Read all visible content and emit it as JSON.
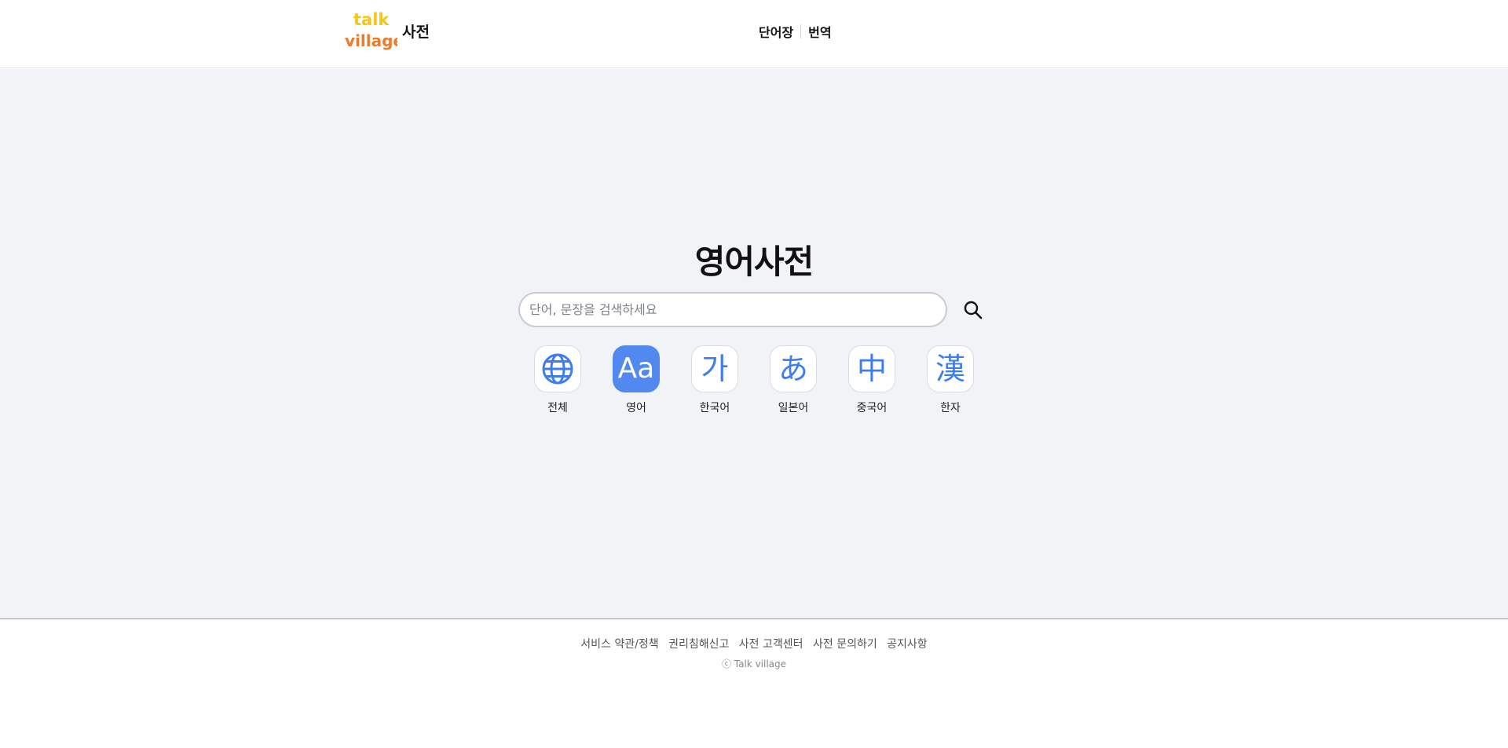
{
  "header": {
    "logo": {
      "line1": "talk",
      "line2": "village",
      "color_top": "#f5c518",
      "color_bottom": "#f07a2a"
    },
    "site_name": "사전",
    "nav": [
      {
        "label": "단어장"
      },
      {
        "label": "번역"
      }
    ]
  },
  "main": {
    "title": "영어사전",
    "search": {
      "placeholder": "단어, 문장을 검색하세요",
      "value": ""
    },
    "accent_color": "#5289f0",
    "categories": [
      {
        "glyph": "",
        "icon": "globe-icon",
        "label": "전체",
        "active": false
      },
      {
        "glyph": "Aa",
        "icon": "english-icon",
        "label": "영어",
        "active": true
      },
      {
        "glyph": "가",
        "icon": "korean-icon",
        "label": "한국어",
        "active": false
      },
      {
        "glyph": "あ",
        "icon": "japanese-icon",
        "label": "일본어",
        "active": false
      },
      {
        "glyph": "中",
        "icon": "chinese-icon",
        "label": "중국어",
        "active": false
      },
      {
        "glyph": "漢",
        "icon": "hanja-icon",
        "label": "한자",
        "active": false
      }
    ]
  },
  "footer": {
    "links": [
      {
        "label": "서비스 약관/정책"
      },
      {
        "label": "권리침해신고"
      },
      {
        "label": "사전 고객센터"
      },
      {
        "label": "사전 문의하기"
      },
      {
        "label": "공지사항"
      }
    ],
    "copyright": "ⓒ Talk village"
  }
}
